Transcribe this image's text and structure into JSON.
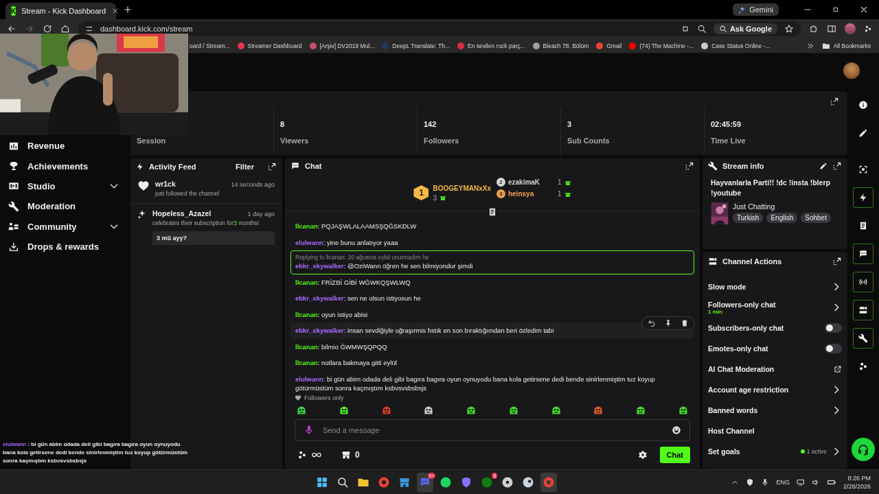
{
  "browser": {
    "tab": {
      "icon_text": "K",
      "title": "Stream - Kick Dashboard"
    },
    "gemini": "Gemini",
    "url": "dashboard.kick.com/stream",
    "ask_google": "Ask Google",
    "bookmarks": [
      {
        "label": "oard / Stream..."
      },
      {
        "label": "Streamer Dashboard",
        "color": "#e8344e"
      },
      {
        "label": "[Arşiv] DV2019 Mul...",
        "color": "#c94f6d"
      },
      {
        "label": "DeepL Translate: Th...",
        "color": "#1b3a5c"
      },
      {
        "label": "En sevilen rock parç...",
        "color": "#d9303a"
      },
      {
        "label": "Bleach 78. Bölüm",
        "color": "#9aa0a6"
      },
      {
        "label": "Gmail",
        "color": "#ea4335"
      },
      {
        "label": "(74) The Machine -...",
        "color": "#ff0000"
      },
      {
        "label": "Case Status Online -...",
        "color": "#c7cdd4"
      }
    ],
    "all_bookmarks": "All Bookmarks"
  },
  "sidebar": {
    "items": [
      {
        "label": "Revenue",
        "expandable": false
      },
      {
        "label": "Achievements",
        "expandable": false
      },
      {
        "label": "Studio",
        "expandable": true
      },
      {
        "label": "Moderation",
        "expandable": false
      },
      {
        "label": "Community",
        "expandable": true
      },
      {
        "label": "Drops & rewards",
        "expandable": false
      }
    ],
    "overlay_chat": {
      "user": "elulwann",
      "separator": " : ",
      "text": "bi gün abim odada deli gibi bagıra bagıra oyun oynuyodu bana kola getirsene dedi bende sinirlenmiştim tuz koyup götürmüstüm sonra kaçmıştım ksbvsvsbsbsjs"
    }
  },
  "stats": [
    {
      "label": "Session"
    },
    {
      "value": "8",
      "label": "Viewers"
    },
    {
      "value": "142",
      "label": "Followers"
    },
    {
      "value": "3",
      "label": "Sub Counts"
    },
    {
      "value": "02:45:59",
      "label": "Time Live"
    }
  ],
  "activity_feed": {
    "title": "Activity Feed",
    "filter": "Filter",
    "items": [
      {
        "kind": "follow",
        "user": "wr1ck",
        "time": "14 seconds ago",
        "text": "just followed the channel"
      },
      {
        "kind": "subscription",
        "user": "Hopeless_Azazel",
        "time": "1 day ago",
        "text": "celebrates their subscription for",
        "count": "3",
        "suffix": "months!",
        "message": "3 mü ayy?"
      }
    ]
  },
  "chat": {
    "title": "Chat",
    "separator": ":",
    "gifters": [
      {
        "rank": "1",
        "name": "BOOGEYMANxXx",
        "count": "3",
        "color": "#f5b941"
      },
      {
        "rank": "2",
        "name": "ezakimaK",
        "count": "1",
        "color": "#d6d6d6"
      },
      {
        "rank": "3",
        "name": "heinsya",
        "count": "1",
        "color": "#f0a050"
      }
    ],
    "messages": [
      {
        "user": "llcanan",
        "color": "#53fc18",
        "text": "PQJAŞWLALAAMSŞQĞSKDLW",
        "hovered": false
      },
      {
        "user": "elulwann",
        "color": "#a76bff",
        "text": "yine bunu anlatıyor yaaa",
        "hovered": false
      },
      {
        "user": "ebkr_skywalker",
        "color": "#a76bff",
        "text": "@OziWann öğren he sen bilmiyondur şimdi",
        "reply_to": "Replying to llcanan: 20 ağustos eylul unutmadım he",
        "hovered": false
      },
      {
        "user": "llcanan",
        "color": "#53fc18",
        "text": "FRİZBİ GİBİ WĞWKQŞWLWQ",
        "hovered": false
      },
      {
        "user": "ebkr_skywalker",
        "color": "#a76bff",
        "text": "sen ne olsun istiyosun he",
        "hovered": false
      },
      {
        "user": "llcanan",
        "color": "#53fc18",
        "text": "oyun istiyo abisi",
        "hovered": false
      },
      {
        "user": "ebkr_skywalker",
        "color": "#a76bff",
        "text": "insan sevdiğiyle uğraşırmis fıstık en son bıraktığımdan beri özledim tabi",
        "hovered": true
      },
      {
        "user": "llcanan",
        "color": "#53fc18",
        "text": "bilmio ĞWMWŞQPQQ",
        "hovered": false
      },
      {
        "user": "llcanan",
        "color": "#53fc18",
        "text": "notlara bakmaya gitti eylül",
        "hovered": false
      },
      {
        "user": "elulwann",
        "color": "#a76bff",
        "text": "bi gün abim odada deli gibi bagıra bagıra oyun oynuyodu bana kola getirsene dedi bende sinirlenmiştim tuz koyup götürmüstüm sonra kaçmıştım ksbvsvsbsbsjs",
        "hovered": false
      }
    ],
    "followers_only": "Followers only",
    "placeholder": "Send a message",
    "store_count": "0",
    "send": "Chat"
  },
  "stream_info": {
    "title": "Stream info",
    "stream_title": "Hayvanlarla Parti!! !dc !insta !blerp !youtube",
    "category": "Just Chatting",
    "tags": [
      "Turkish",
      "English",
      "Sohbet"
    ]
  },
  "channel_actions": {
    "title": "Channel Actions",
    "items": [
      {
        "label": "Slow mode",
        "kind": "link"
      },
      {
        "label": "Followers-only chat",
        "kind": "link",
        "detail": "1 min"
      },
      {
        "label": "Subscribers-only chat",
        "kind": "toggle",
        "on": false
      },
      {
        "label": "Emotes-only chat",
        "kind": "toggle",
        "on": false
      },
      {
        "label": "AI Chat Moderation",
        "kind": "external"
      },
      {
        "label": "Account age restriction",
        "kind": "link"
      },
      {
        "label": "Banned words",
        "kind": "link"
      },
      {
        "label": "Host Channel",
        "kind": "plain"
      },
      {
        "label": "Set goals",
        "kind": "link",
        "status": "1 active"
      }
    ]
  },
  "rail": [
    {
      "kind": "info",
      "selected": false
    },
    {
      "kind": "pencil",
      "selected": false
    },
    {
      "kind": "focus",
      "selected": false
    },
    {
      "kind": "bolt",
      "selected": true
    },
    {
      "kind": "doc",
      "selected": false
    },
    {
      "kind": "chat",
      "selected": true
    },
    {
      "kind": "broadcast",
      "selected": true
    },
    {
      "kind": "camera",
      "selected": true
    },
    {
      "kind": "wrench",
      "selected": true
    },
    {
      "kind": "dots",
      "selected": false
    }
  ],
  "taskbar": {
    "apps": [
      {
        "kind": "start",
        "color": "#4cc2ff",
        "selected": false
      },
      {
        "kind": "search",
        "color": "#e8e8e8",
        "selected": false
      },
      {
        "kind": "folder",
        "color": "#f3c233",
        "selected": false
      },
      {
        "kind": "browser",
        "color": "#e94235",
        "selected": false
      },
      {
        "kind": "store",
        "color": "#3a96dd",
        "selected": false
      },
      {
        "kind": "chat",
        "color": "#5865f2",
        "selected": true,
        "badge": "9+"
      },
      {
        "kind": "music",
        "color": "#1ed760",
        "selected": false
      },
      {
        "kind": "shield",
        "color": "#8a6cff",
        "selected": false
      },
      {
        "kind": "game",
        "color": "#107c10",
        "selected": false,
        "badge": "8"
      },
      {
        "kind": "disc",
        "color": "#cfcfcf",
        "selected": false
      },
      {
        "kind": "steam",
        "color": "#c7d5e0",
        "selected": false
      },
      {
        "kind": "browser",
        "color": "#e94235",
        "selected": true
      }
    ],
    "language": "ENG",
    "time": "8:26 PM",
    "date": "2/28/2026"
  }
}
